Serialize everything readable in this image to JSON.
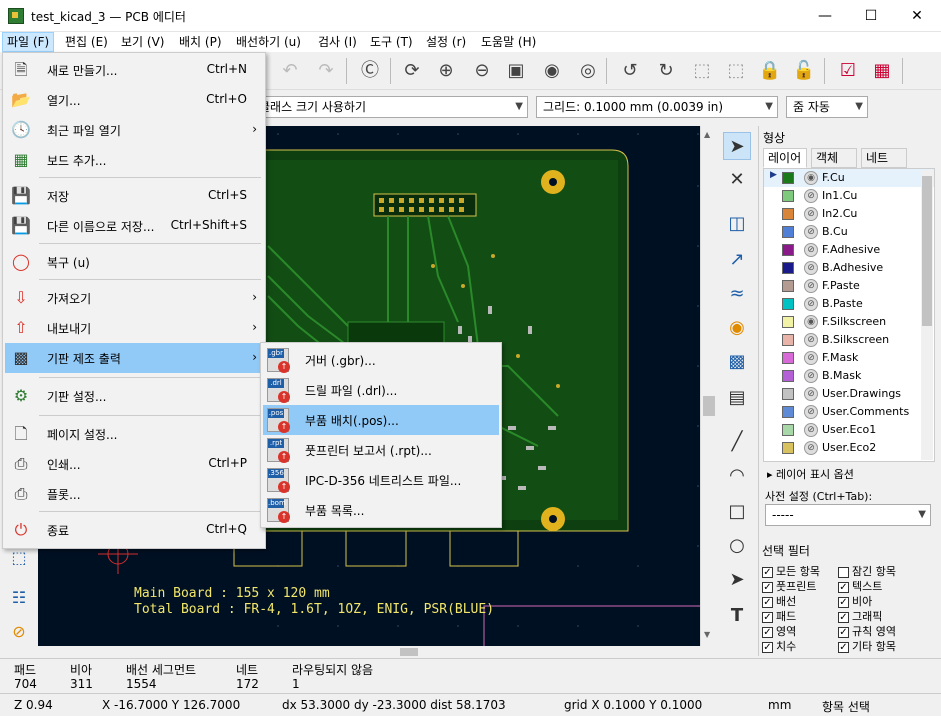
{
  "window": {
    "title": "test_kicad_3 — PCB 에디터"
  },
  "menubar": [
    "파일 (F)",
    "편집 (E)",
    "보기 (V)",
    "배치 (P)",
    "배선하기 (u)",
    "검사 (I)",
    "도구 (T)",
    "설정 (r)",
    "도움말 (H)"
  ],
  "auxbar": {
    "track": "트랙: 네트클래스 크기 사용하기",
    "grid": "그리드: 0.1000 mm (0.0039 in)",
    "zoom": "줌 자동"
  },
  "file_menu": {
    "items": [
      {
        "icon": "new-icon",
        "label": "새로 만들기...",
        "shortcut": "Ctrl+N"
      },
      {
        "icon": "open-folder-icon",
        "label": "열기...",
        "shortcut": "Ctrl+O"
      },
      {
        "icon": "recent-clock-icon",
        "label": "최근 파일 열기",
        "submenu": true
      },
      {
        "icon": "add-board-icon",
        "label": "보드 추가..."
      },
      {
        "icon": "save-icon",
        "label": "저장",
        "shortcut": "Ctrl+S"
      },
      {
        "icon": "save-as-icon",
        "label": "다른 이름으로 저장...",
        "shortcut": "Ctrl+Shift+S"
      },
      {
        "icon": "revert-icon",
        "label": "복구 (u)"
      },
      {
        "icon": "import-icon",
        "label": "가져오기",
        "submenu": true
      },
      {
        "icon": "export-icon",
        "label": "내보내기",
        "submenu": true
      },
      {
        "icon": "fabrication-icon",
        "label": "기판 제조 출력",
        "submenu": true
      },
      {
        "icon": "board-setup-icon",
        "label": "기판 설정..."
      },
      {
        "icon": "page-setup-icon",
        "label": "페이지 설정..."
      },
      {
        "icon": "print-icon",
        "label": "인쇄...",
        "shortcut": "Ctrl+P"
      },
      {
        "icon": "plot-icon",
        "label": "플롯..."
      },
      {
        "icon": "exit-icon",
        "label": "종료",
        "shortcut": "Ctrl+Q"
      }
    ]
  },
  "fab_submenu": {
    "items": [
      {
        "ext": ".gbr",
        "label": "거버 (.gbr)..."
      },
      {
        "ext": ".drl",
        "label": "드릴 파일 (.drl)..."
      },
      {
        "ext": ".pos",
        "label": "부품 배치(.pos)..."
      },
      {
        "ext": ".rpt",
        "label": "풋프린터 보고서 (.rpt)..."
      },
      {
        "ext": ".356",
        "label": "IPC-D-356 네트리스트 파일..."
      },
      {
        "ext": ".bom",
        "label": "부품 목록..."
      }
    ]
  },
  "canvas": {
    "silk_line1": "Main Board : 155 x 120 mm",
    "silk_line2": "Total Board : FR-4, 1.6T, 1OZ, ENIG, PSR(BLUE)"
  },
  "panel": {
    "title": "형상",
    "tabs": [
      "레이어",
      "객체",
      "네트"
    ],
    "layers": [
      {
        "name": "F.Cu",
        "color": "#1a7a1a"
      },
      {
        "name": "In1.Cu",
        "color": "#7fc97f"
      },
      {
        "name": "In2.Cu",
        "color": "#d8853a"
      },
      {
        "name": "B.Cu",
        "color": "#4f7fd6"
      },
      {
        "name": "F.Adhesive",
        "color": "#8a1a8a"
      },
      {
        "name": "B.Adhesive",
        "color": "#1a1a8a"
      },
      {
        "name": "F.Paste",
        "color": "#b39b91"
      },
      {
        "name": "B.Paste",
        "color": "#00c2c2"
      },
      {
        "name": "F.Silkscreen",
        "color": "#f2f2a6"
      },
      {
        "name": "B.Silkscreen",
        "color": "#e8b3a8"
      },
      {
        "name": "F.Mask",
        "color": "#d86ad8"
      },
      {
        "name": "B.Mask",
        "color": "#b35fd6"
      },
      {
        "name": "User.Drawings",
        "color": "#c2c2c2"
      },
      {
        "name": "User.Comments",
        "color": "#5f8ad6"
      },
      {
        "name": "User.Eco1",
        "color": "#a8d8a8"
      },
      {
        "name": "User.Eco2",
        "color": "#d8c25f"
      }
    ],
    "layer_options": "레이어 표시 옵션",
    "preset_label": "사전 설정 (Ctrl+Tab):",
    "preset_value": "-----"
  },
  "filter": {
    "title": "선택 필터",
    "items": [
      "모든 항목",
      "잠긴 항목",
      "풋프린트",
      "텍스트",
      "배선",
      "비아",
      "패드",
      "그래픽",
      "영역",
      "규칙 영역",
      "치수",
      "기타 항목"
    ]
  },
  "status": {
    "pads_label": "패드",
    "pads": "704",
    "vias_label": "비아",
    "vias": "311",
    "segments_label": "배선 세그먼트",
    "segments": "1554",
    "nets_label": "네트",
    "nets": "172",
    "unrouted_label": "라우팅되지 않음",
    "unrouted": "1",
    "zoom": "Z 0.94",
    "xy": "X -16.7000  Y 126.7000",
    "dxy": "dx 53.3000  dy -23.3000  dist 58.1703",
    "grid": "grid X 0.1000  Y 0.1000",
    "units": "mm",
    "mode": "항목 선택"
  }
}
